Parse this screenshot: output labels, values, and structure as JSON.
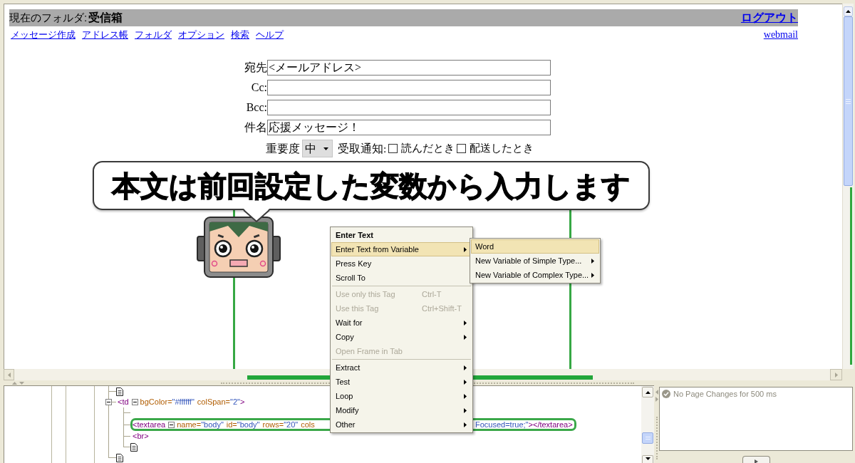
{
  "header": {
    "folder_label": "現在のフォルダ:",
    "folder_name": "受信箱",
    "logout_link": "ログアウト"
  },
  "nav_links": [
    "メッセージ作成",
    "アドレス帳",
    "フォルダ",
    "オプション",
    "検索",
    "ヘルプ"
  ],
  "brand_link": "webmail",
  "compose_form": {
    "fields": [
      {
        "label": "宛先",
        "value": "<メールアドレス>"
      },
      {
        "label": "Cc:"
      },
      {
        "label": "Bcc:"
      },
      {
        "label": "件名",
        "value": "応援メッセージ！"
      }
    ],
    "priority": {
      "label": "重要度",
      "value": "中"
    },
    "receipt": {
      "label": "受取通知:",
      "options": [
        {
          "label": "読んだとき",
          "checked": false
        },
        {
          "label": "配送したとき",
          "checked": false
        }
      ]
    },
    "body": {
      "highlighted": true
    }
  },
  "callout": {
    "text": "本文は前回設定した変数から入力します"
  },
  "context_menu": {
    "items": [
      {
        "kind": "item",
        "label": "Enter Text",
        "default": true,
        "selected": false,
        "disabled": false,
        "submenu": false
      },
      {
        "kind": "item",
        "label": "Enter Text from Variable",
        "default": false,
        "selected": true,
        "disabled": false,
        "submenu": true
      },
      {
        "kind": "item",
        "label": "Press Key",
        "default": false,
        "selected": false,
        "disabled": false,
        "submenu": false
      },
      {
        "kind": "item",
        "label": "Scroll To",
        "default": false,
        "selected": false,
        "disabled": false,
        "submenu": false
      },
      {
        "kind": "separator"
      },
      {
        "kind": "item",
        "label": "Use only this Tag",
        "shortcut": "Ctrl-T",
        "default": false,
        "selected": false,
        "disabled": true,
        "submenu": false
      },
      {
        "kind": "item",
        "label": "Use this Tag",
        "shortcut": "Ctrl+Shift-T",
        "default": false,
        "selected": false,
        "disabled": true,
        "submenu": false
      },
      {
        "kind": "item",
        "label": "Wait for",
        "default": false,
        "selected": false,
        "disabled": false,
        "submenu": true
      },
      {
        "kind": "item",
        "label": "Copy",
        "default": false,
        "selected": false,
        "disabled": false,
        "submenu": true
      },
      {
        "kind": "item",
        "label": "Open Frame in Tab",
        "default": false,
        "selected": false,
        "disabled": true,
        "submenu": false
      },
      {
        "kind": "separator"
      },
      {
        "kind": "item",
        "label": "Extract",
        "default": false,
        "selected": false,
        "disabled": false,
        "submenu": true
      },
      {
        "kind": "item",
        "label": "Test",
        "default": false,
        "selected": false,
        "disabled": false,
        "submenu": true
      },
      {
        "kind": "item",
        "label": "Loop",
        "default": false,
        "selected": false,
        "disabled": false,
        "submenu": true
      },
      {
        "kind": "item",
        "label": "Modify",
        "default": false,
        "selected": false,
        "disabled": false,
        "submenu": true
      },
      {
        "kind": "item",
        "label": "Other",
        "default": false,
        "selected": false,
        "disabled": false,
        "submenu": true
      }
    ]
  },
  "submenu": {
    "items": [
      {
        "label": "Word",
        "selected": true,
        "submenu": false
      },
      {
        "label": "New Variable of Simple Type...",
        "selected": false,
        "submenu": true
      },
      {
        "label": "New Variable of Complex Type...",
        "selected": false,
        "submenu": true
      }
    ]
  },
  "dom_tree": {
    "nodes": [
      {
        "kind": "text",
        "selected": false
      },
      {
        "kind": "element",
        "selected": false,
        "expanded": true,
        "tag": "<td",
        "attributes_expanded": true,
        "attributes": [
          {
            "name": "bgColor=",
            "value": "\"#ffffff\""
          },
          {
            "name": "colSpan=",
            "value": "\"2\""
          }
        ],
        "close": ">",
        "children": [
          {
            "kind": "blank",
            "selected": false
          },
          {
            "kind": "element",
            "selected": true,
            "tag": "<textarea",
            "attributes_expanded": true,
            "attributes": [
              {
                "name": "name=",
                "value": "\"body\""
              },
              {
                "name": "id=",
                "value": "\"body\""
              },
              {
                "name": "rows=",
                "value": "\"20\""
              },
              {
                "name": "cols"
              }
            ],
            "trailing": [
              {
                "kind": "value",
                "text": "Focused=true;\""
              },
              {
                "kind": "tag",
                "text": "></textarea>"
              }
            ]
          },
          {
            "kind": "element",
            "selected": false,
            "tag": "<br>"
          },
          {
            "kind": "text",
            "selected": false
          }
        ]
      },
      {
        "kind": "text",
        "selected": false
      }
    ]
  },
  "status_panel": {
    "message": "No Page Changes for 500 ms"
  }
}
